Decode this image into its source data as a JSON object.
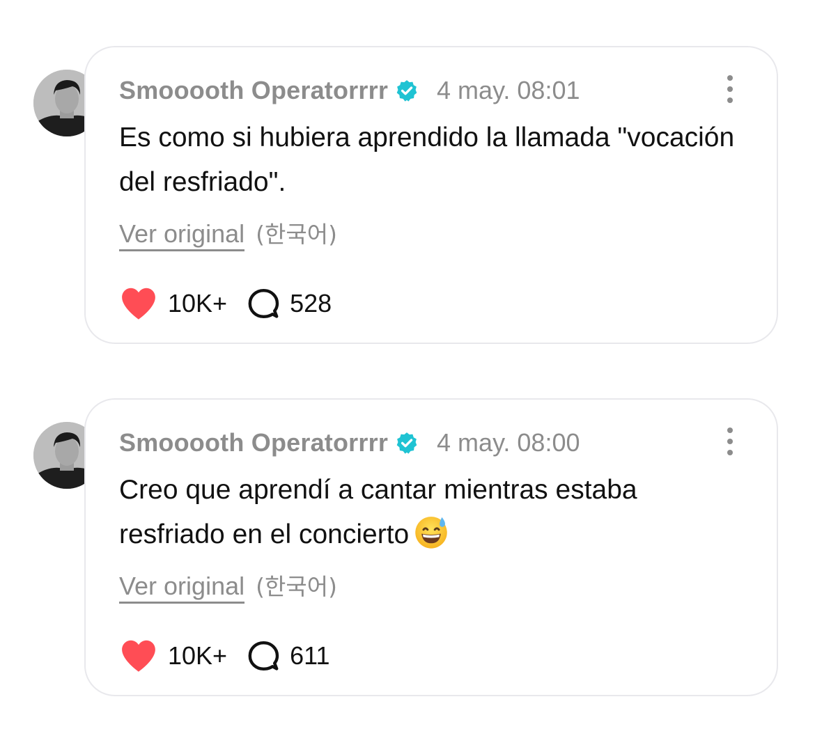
{
  "colors": {
    "verified": "#1fc3d3",
    "like": "#ff4d55",
    "muted_text": "#8c8c8c",
    "card_border": "#e8e8ec"
  },
  "posts": [
    {
      "author": "Smooooth Operatorrrr",
      "verified_icon": "verified-badge-icon",
      "timestamp": "4 may. 08:01",
      "text": "Es como si hubiera aprendido la llamada \"vocación del resfriado\".",
      "emoji": "",
      "view_original_label": "Ver original",
      "original_language": "(한국어)",
      "likes": "10K+",
      "replies": "528"
    },
    {
      "author": "Smooooth Operatorrrr",
      "verified_icon": "verified-badge-icon",
      "timestamp": "4 may. 08:00",
      "text": "Creo que aprendí a cantar mientras estaba resfriado en el concierto",
      "emoji": "grinning-face-with-sweat-icon",
      "view_original_label": "Ver original",
      "original_language": "(한국어)",
      "likes": "10K+",
      "replies": "611"
    }
  ]
}
